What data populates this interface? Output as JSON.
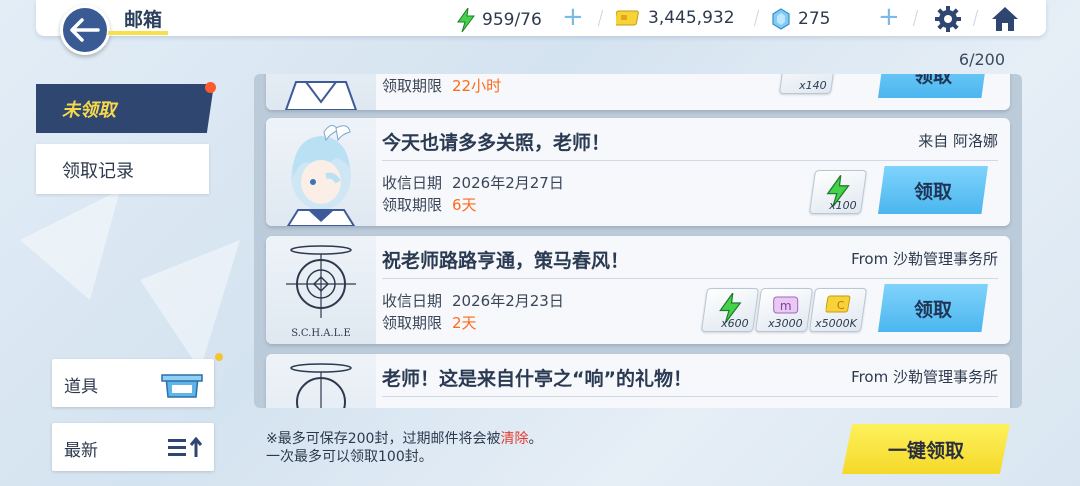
{
  "header": {
    "title": "邮箱",
    "stamina": "959/76",
    "credits": "3,445,932",
    "gems": "275"
  },
  "counter": "6/200",
  "tabs": {
    "unclaimed": "未领取",
    "history": "领取记录"
  },
  "mails": [
    {
      "partial_line": "领取期限",
      "partial_value": "22小时",
      "reward_count": "x140",
      "claim_label": "领取"
    },
    {
      "title": "今天也请多多关照，老师！",
      "sender": "来自 阿洛娜",
      "received_label": "收信日期",
      "received_date": "2026年2月27日",
      "deadline_label": "领取期限",
      "deadline": "6天",
      "rewards": [
        {
          "icon": "stamina-bolt-icon",
          "count": "x100"
        }
      ],
      "claim_label": "领取"
    },
    {
      "title": "祝老师路路亨通，策马春风！",
      "sender": "From 沙勒管理事务所",
      "avatar_text": "S.C.H.A.L.E",
      "received_label": "收信日期",
      "received_date": "2026年2月23日",
      "deadline_label": "领取期限",
      "deadline": "2天",
      "rewards": [
        {
          "icon": "stamina-bolt-icon",
          "count": "x600"
        },
        {
          "icon": "mail-ticket-icon",
          "count": "x3000"
        },
        {
          "icon": "credit-card-icon",
          "count": "x5000K"
        }
      ],
      "claim_label": "领取"
    },
    {
      "title": "老师！这是来自什亭之“响”的礼物！",
      "sender": "From 沙勒管理事务所"
    }
  ],
  "side": {
    "items_label": "道具",
    "sort_label": "最新"
  },
  "notes": {
    "line1_prefix": "※最多可保存200封，过期邮件将会被",
    "line1_red": "清除",
    "line1_suffix": "。",
    "line2": "一次最多可以领取100封。"
  },
  "claim_all": "一键领取",
  "colors": {
    "accent_blue": "#4bb6ef",
    "tab_dark": "#2f4670",
    "tab_gold": "#f5d94a",
    "deadline_orange": "#ff6a1a",
    "claim_all_yellow": "#f5d92a"
  }
}
